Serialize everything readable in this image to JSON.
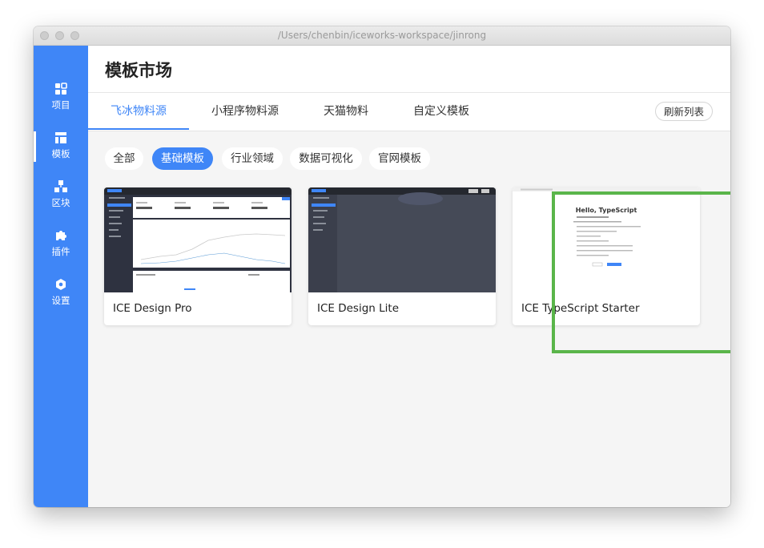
{
  "window": {
    "title": "/Users/chenbin/iceworks-workspace/jinrong"
  },
  "sidebar": {
    "items": [
      {
        "label": "项目",
        "icon": "project-grid-icon"
      },
      {
        "label": "模板",
        "icon": "template-layout-icon",
        "active": true
      },
      {
        "label": "区块",
        "icon": "blocks-icon"
      },
      {
        "label": "插件",
        "icon": "puzzle-icon"
      },
      {
        "label": "设置",
        "icon": "gear-icon"
      }
    ]
  },
  "header": {
    "title": "模板市场"
  },
  "tabs": {
    "items": [
      {
        "label": "飞冰物料源",
        "active": true
      },
      {
        "label": "小程序物料源"
      },
      {
        "label": "天猫物料"
      },
      {
        "label": "自定义模板"
      }
    ],
    "refresh_label": "刷新列表"
  },
  "filters": {
    "items": [
      {
        "label": "全部"
      },
      {
        "label": "基础模板",
        "active": true
      },
      {
        "label": "行业领域"
      },
      {
        "label": "数据可视化"
      },
      {
        "label": "官网模板"
      }
    ]
  },
  "templates": [
    {
      "name": "ICE Design Pro"
    },
    {
      "name": "ICE Design Lite"
    },
    {
      "name": "ICE TypeScript Starter",
      "preview_title": "Hello, TypeScript",
      "highlighted": true
    }
  ],
  "colors": {
    "accent": "#3f86f7",
    "highlight": "#5ab54a",
    "sidebar": "#3f86f7"
  }
}
